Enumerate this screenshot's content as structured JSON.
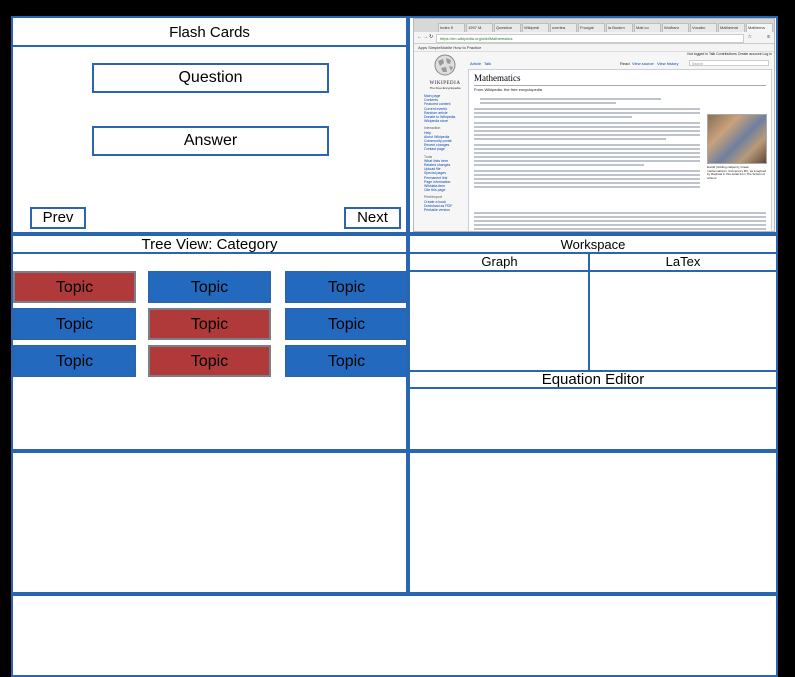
{
  "flashcards": {
    "title": "Flash Cards",
    "question_label": "Question",
    "answer_label": "Answer",
    "prev_label": "Prev",
    "next_label": "Next"
  },
  "browser": {
    "tabs": [
      "Index fi",
      "1997 M.",
      "Question",
      "Wikipedi",
      "overlea",
      "Froogal",
      "la Bookm",
      "Mail.co",
      "Wolfram",
      "Vocabu",
      "Mathemat",
      "Mathema"
    ],
    "url": "https://en.wikipedia.org/wiki/Mathematics",
    "bookmarks": "Apps   SimpleMobile   How to Practice",
    "wiki_logo_name": "WIKIPEDIA",
    "wiki_tagline": "The Free Encyclopedia",
    "article_title": "Mathematics",
    "from_text": "From Wikipedia, the free encyclopedia",
    "tab_article": "Article",
    "tab_talk": "Talk",
    "tab_read": "Read",
    "tab_view_source": "View source",
    "tab_view_history": "View history",
    "search_placeholder": "Search",
    "user_links": "Not logged in  Talk  Contributions  Create account  Log in",
    "sidebar_links": [
      "Main page",
      "Contents",
      "Featured content",
      "Current events",
      "Random article",
      "Donate to Wikipedia",
      "Wikipedia store"
    ],
    "sidebar_interaction": [
      "Interaction",
      "Help",
      "About Wikipedia",
      "Community portal",
      "Recent changes",
      "Contact page"
    ],
    "sidebar_tools": [
      "Tools",
      "What links here",
      "Related changes",
      "Upload file",
      "Special pages",
      "Permanent link",
      "Page information",
      "Wikidata item",
      "Cite this page"
    ],
    "sidebar_print": [
      "Print/export",
      "Create a book",
      "Download as PDF",
      "Printable version"
    ],
    "image_caption": "Euclid (holding calipers), Greek mathematician, 3rd century BC, as imagined by Raphael in this detail from The School of Athens."
  },
  "treeview": {
    "title": "Tree View: Category",
    "topics": [
      {
        "label": "Topic",
        "color": "#b0393a"
      },
      {
        "label": "Topic",
        "color": "#2369bd"
      },
      {
        "label": "Topic",
        "color": "#2369bd"
      },
      {
        "label": "Topic",
        "color": "#2369bd"
      },
      {
        "label": "Topic",
        "color": "#b0393a"
      },
      {
        "label": "Topic",
        "color": "#2369bd"
      },
      {
        "label": "Topic",
        "color": "#2369bd"
      },
      {
        "label": "Topic",
        "color": "#b0393a"
      },
      {
        "label": "Topic",
        "color": "#2369bd"
      }
    ]
  },
  "workspace": {
    "title": "Workspace",
    "graph_label": "Graph",
    "latex_label": "LaTex",
    "equation_editor_label": "Equation Editor"
  },
  "colors": {
    "border": "#2a66b0",
    "topic_blue": "#2369bd",
    "topic_red": "#b0393a"
  }
}
